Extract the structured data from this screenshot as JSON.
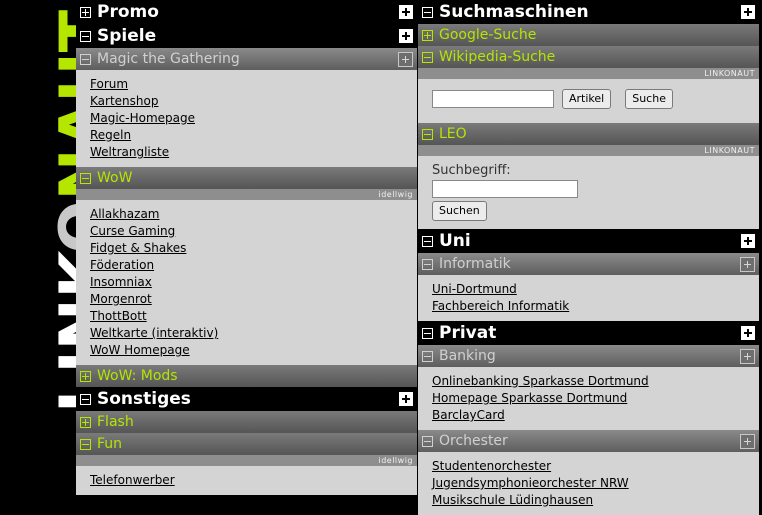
{
  "logo": {
    "part1": "LINK",
    "part2": "O",
    "part3": "NAUT"
  },
  "left": {
    "promo": {
      "title": "Promo"
    },
    "spiele": {
      "title": "Spiele"
    },
    "magic": {
      "title": "Magic the Gathering",
      "links": [
        "Forum",
        "Kartenshop",
        "Magic-Homepage",
        "Regeln",
        "Weltrangliste"
      ]
    },
    "wow": {
      "title": "WoW",
      "tag": "idellwig",
      "links": [
        "Allakhazam",
        "Curse Gaming",
        "Fidget & Shakes",
        "Föderation",
        "Insomniax",
        "Morgenrot",
        "ThottBott",
        "Weltkarte (interaktiv)",
        "WoW Homepage"
      ]
    },
    "wowmods": {
      "title": "WoW: Mods"
    },
    "sonstiges": {
      "title": "Sonstiges"
    },
    "flash": {
      "title": "Flash"
    },
    "fun": {
      "title": "Fun",
      "tag": "idellwig",
      "links": [
        "Telefonwerber"
      ]
    }
  },
  "right": {
    "such": {
      "title": "Suchmaschinen"
    },
    "google": {
      "title": "Google-Suche"
    },
    "wiki": {
      "title": "Wikipedia-Suche",
      "tag": "LINKONAUT",
      "btn1": "Artikel",
      "btn2": "Suche",
      "value": ""
    },
    "leo": {
      "title": "LEO",
      "tag": "LINKONAUT",
      "label": "Suchbegriff:",
      "btn": "Suchen",
      "value": ""
    },
    "uni": {
      "title": "Uni"
    },
    "informatik": {
      "title": "Informatik",
      "links": [
        "Uni-Dortmund",
        "Fachbereich Informatik"
      ]
    },
    "privat": {
      "title": "Privat"
    },
    "banking": {
      "title": "Banking",
      "links": [
        "Onlinebanking Sparkasse Dortmund",
        "Homepage Sparkasse Dortmund",
        "BarclayCard"
      ]
    },
    "orchester": {
      "title": "Orchester",
      "links": [
        "Studentenorchester",
        "Jugendsymphonieorchester NRW",
        "Musikschule Lüdinghausen"
      ]
    }
  }
}
